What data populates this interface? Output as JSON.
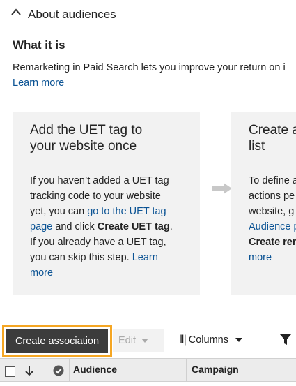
{
  "section": {
    "title": "About audiences",
    "heading": "What it is",
    "description": "Remarketing in Paid Search lets you improve your return on i",
    "learn_more": "Learn more"
  },
  "cards": [
    {
      "title_line1": "Add the UET tag to",
      "title_line2": "your website once",
      "body_line1": "If you haven’t added a UET tag",
      "body_line2": "tracking code to your website",
      "body_line3_pre": "yet, you can ",
      "body_link_1": "go to the UET tag",
      "body_link_2": "page",
      "body_line4_mid": " and click ",
      "body_bold": "Create UET tag",
      "body_line4_end": ".",
      "body_line5": "If you already have a UET tag,",
      "body_line6_pre": "you can skip this step. ",
      "body_link_3": "Learn",
      "body_link_4": "more"
    },
    {
      "title_line1": "Create a",
      "title_line2": "list",
      "body_line1": "To define a",
      "body_line2": "actions pe",
      "body_line3": "website, g",
      "body_link_1": "Audience p",
      "body_bold": "Create rem",
      "body_link_2": "more"
    }
  ],
  "toolbar": {
    "create_association": "Create association",
    "edit": "Edit",
    "columns": "Columns"
  },
  "grid": {
    "columns": [
      "Audience",
      "Campaign"
    ]
  },
  "colors": {
    "highlight": "#f5a623",
    "link": "#0b5394",
    "primary_button": "#3c3c3c"
  }
}
